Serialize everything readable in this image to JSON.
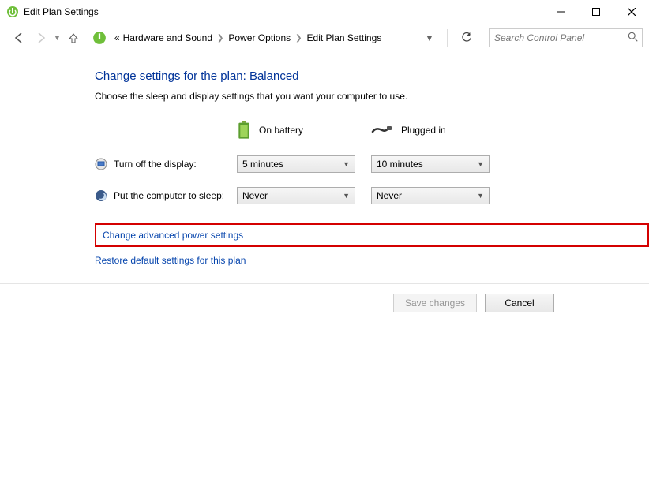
{
  "window": {
    "title": "Edit Plan Settings"
  },
  "breadcrumb": {
    "prefix": "«",
    "items": [
      "Hardware and Sound",
      "Power Options",
      "Edit Plan Settings"
    ]
  },
  "search": {
    "placeholder": "Search Control Panel"
  },
  "page": {
    "heading": "Change settings for the plan: Balanced",
    "sub": "Choose the sleep and display settings that you want your computer to use."
  },
  "columns": {
    "battery": "On battery",
    "plugged": "Plugged in"
  },
  "rows": {
    "display": {
      "label": "Turn off the display:",
      "battery_value": "5 minutes",
      "plugged_value": "10 minutes"
    },
    "sleep": {
      "label": "Put the computer to sleep:",
      "battery_value": "Never",
      "plugged_value": "Never"
    }
  },
  "links": {
    "advanced": "Change advanced power settings",
    "restore": "Restore default settings for this plan"
  },
  "buttons": {
    "save": "Save changes",
    "cancel": "Cancel"
  }
}
